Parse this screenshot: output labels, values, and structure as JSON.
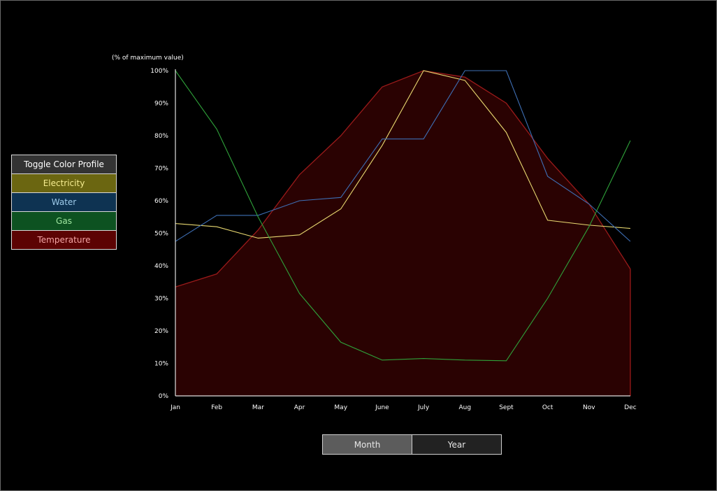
{
  "legend": {
    "toggle_label": "Toggle Color Profile",
    "toggle_bg": "#333333",
    "toggle_fg": "#ffffff"
  },
  "tabs": [
    {
      "label": "Month",
      "bg": "#5c5c5c",
      "fg": "#e6e6e6"
    },
    {
      "label": "Year",
      "bg": "#222222",
      "fg": "#e6e6e6"
    }
  ],
  "chart_data": {
    "type": "line",
    "ylabel": "(% of maximum value)",
    "categories": [
      "Jan",
      "Feb",
      "Mar",
      "Apr",
      "May",
      "June",
      "July",
      "Aug",
      "Sept",
      "Oct",
      "Nov",
      "Dec"
    ],
    "yticks": [
      "0%",
      "10%",
      "20%",
      "30%",
      "40%",
      "50%",
      "60%",
      "70%",
      "80%",
      "90%",
      "100%"
    ],
    "ylim": [
      0,
      100
    ],
    "grid": false,
    "legend_position": "left",
    "series": [
      {
        "name": "Electricity",
        "type": "line",
        "color": "#e8d870",
        "button_bg": "#6b6611",
        "button_fg": "#f5ec90",
        "values": [
          53,
          52,
          48.5,
          49.5,
          57.5,
          77,
          100,
          97,
          81,
          54,
          52.5,
          51.5
        ]
      },
      {
        "name": "Water",
        "type": "line",
        "color": "#3e6fb5",
        "button_bg": "#0e3352",
        "button_fg": "#9ecbea",
        "values": [
          47.5,
          55.5,
          55.5,
          60,
          61,
          79,
          79,
          100,
          100,
          67.5,
          59,
          47.5
        ]
      },
      {
        "name": "Gas",
        "type": "line",
        "color": "#2fa23a",
        "button_bg": "#0d5221",
        "button_fg": "#9fe6a0",
        "values": [
          100,
          82,
          55,
          31.5,
          16.5,
          11,
          11.5,
          11,
          10.8,
          30,
          52,
          78.5
        ]
      },
      {
        "name": "Temperature",
        "type": "area",
        "color": "#9a1a1a",
        "fill": "#2a0202",
        "button_bg": "#5c0303",
        "button_fg": "#f5a6a6",
        "values": [
          33.5,
          37.5,
          51,
          68,
          80,
          95,
          100,
          98,
          90,
          73,
          59,
          39
        ]
      }
    ]
  }
}
